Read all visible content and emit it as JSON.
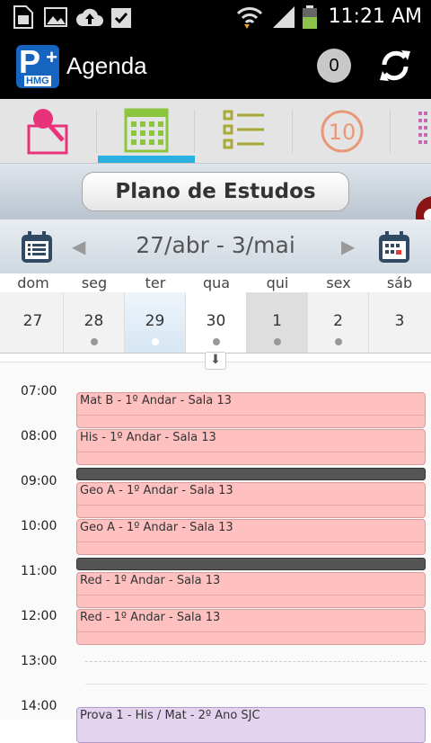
{
  "status_bar": {
    "time": "11:21 AM"
  },
  "action_bar": {
    "title": "Agenda",
    "notification_count": "0",
    "logo_letter": "P",
    "logo_text": "HMG"
  },
  "tabs": [
    {
      "name": "pin",
      "icon": "pushpin-icon",
      "color": "#e8337a"
    },
    {
      "name": "calendar",
      "icon": "calendar-grid-icon",
      "color": "#8cc63f",
      "active": true
    },
    {
      "name": "checklist",
      "icon": "checklist-icon",
      "color": "#a8a838"
    },
    {
      "name": "ten",
      "icon": "ten-circle-icon",
      "color": "#e89878"
    },
    {
      "name": "grid",
      "icon": "grid-icon",
      "color": "#c86ab0"
    }
  ],
  "plan_button_label": "Plano de Estudos",
  "week": {
    "range": "27/abr - 3/mai",
    "prev_arrow": "◀",
    "next_arrow": "▶"
  },
  "days": [
    {
      "name": "dom",
      "num": "27",
      "dot": false
    },
    {
      "name": "seg",
      "num": "28",
      "dot": true
    },
    {
      "name": "ter",
      "num": "29",
      "dot": true,
      "selected": true
    },
    {
      "name": "qua",
      "num": "30",
      "dot": true
    },
    {
      "name": "qui",
      "num": "1",
      "dot": true,
      "today": true
    },
    {
      "name": "sex",
      "num": "2",
      "dot": true
    },
    {
      "name": "sáb",
      "num": "3",
      "dot": false
    }
  ],
  "hours": [
    "07:00",
    "08:00",
    "09:00",
    "10:00",
    "11:00",
    "12:00",
    "13:00",
    "14:00"
  ],
  "events": [
    {
      "label": "Mat B - 1º Andar - Sala 13",
      "kind": "class"
    },
    {
      "label": "His - 1º Andar - Sala 13",
      "kind": "class"
    },
    {
      "label": "Geo A - 1º Andar - Sala 13",
      "kind": "class"
    },
    {
      "label": "Geo A - 1º Andar - Sala 13",
      "kind": "class"
    },
    {
      "label": "Red - 1º Andar - Sala 13",
      "kind": "class"
    },
    {
      "label": "Red - 1º Andar - Sala 13",
      "kind": "class"
    },
    {
      "label": "Prova 1 - His / Mat - 2º Ano SJC",
      "kind": "exam"
    }
  ],
  "colors": {
    "accent": "#29b0e0",
    "event_class": "#ffc0c0",
    "event_exam": "#e3d3ef",
    "break_bar": "#555555"
  }
}
